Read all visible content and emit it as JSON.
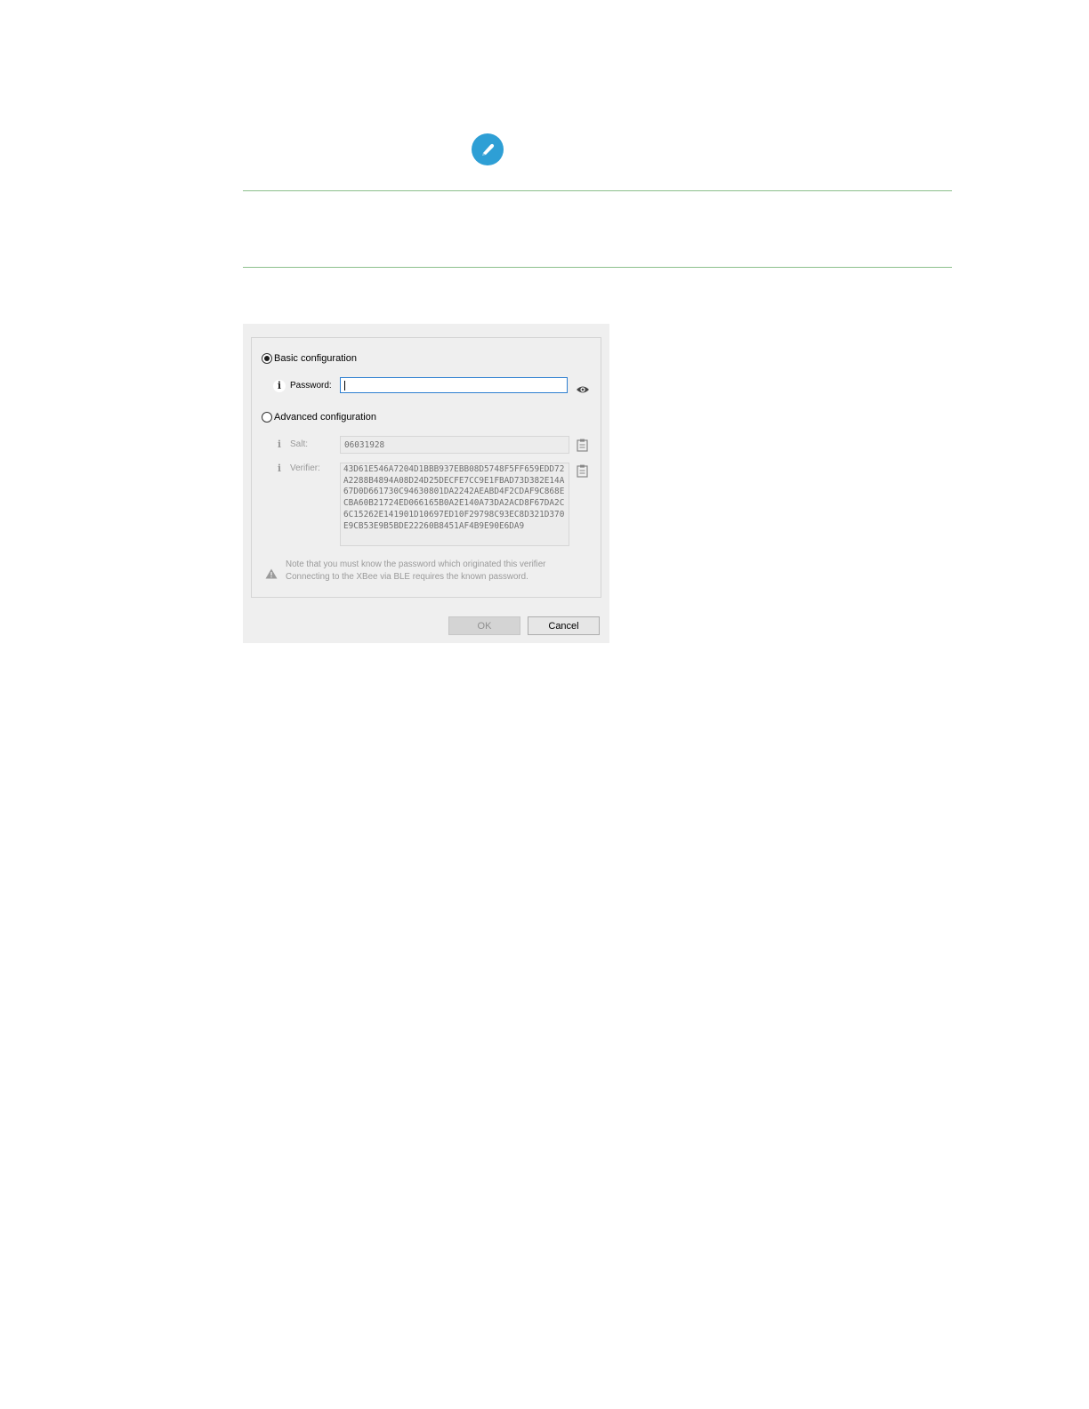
{
  "dialog": {
    "basic_label": "Basic configuration",
    "password_label": "Password:",
    "password_value": "",
    "advanced_label": "Advanced configuration",
    "salt_label": "Salt:",
    "salt_value": "06031928",
    "verifier_label": "Verifier:",
    "verifier_value": "43D61E546A7204D1BBB937EBB08D5748F5FF659EDD72A2288B4894A08D24D25DECFE7CC9E1FBAD73D382E14A67D0D661730C94630801DA2242AEABD4F2CDAF9C868ECBA60B21724ED066165B0A2E140A73DA2ACD8F67DA2C6C15262E141901D10697ED10F29798C93EC8D321D370E9CB53E9B5BDE22260B8451AF4B9E90E6DA9",
    "warning_line1": "Note that you must know the password which originated this verifier",
    "warning_line2": "Connecting to the XBee via BLE requires the known password.",
    "ok_label": "OK",
    "cancel_label": "Cancel",
    "basic_selected": true
  },
  "icons": {
    "header": "pencil-icon",
    "reveal": "eye-icon",
    "copy": "clipboard-icon",
    "info": "info-icon",
    "warning": "warning-icon"
  },
  "colors": {
    "accent": "#2e9fd5",
    "rule": "#8cc08c",
    "focus_border": "#2e7fd0",
    "dialog_bg": "#efefef"
  }
}
